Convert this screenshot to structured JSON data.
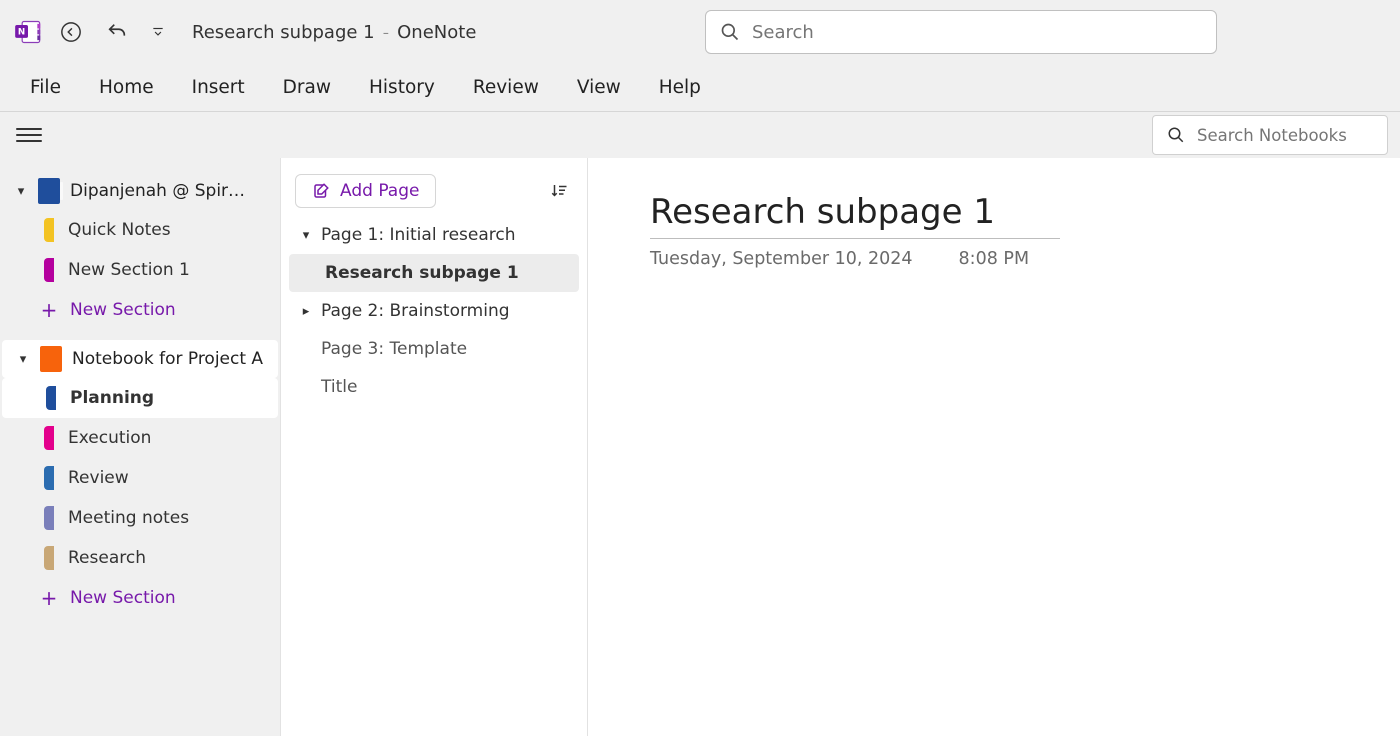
{
  "titlebar": {
    "page_name": "Research subpage 1",
    "app_name": "OneNote"
  },
  "search": {
    "placeholder": "Search"
  },
  "ribbon": [
    "File",
    "Home",
    "Insert",
    "Draw",
    "History",
    "Review",
    "View",
    "Help"
  ],
  "search_notebooks": {
    "placeholder": "Search Notebooks"
  },
  "sidebar": {
    "notebooks": [
      {
        "label": "Dipanjenah @ Spiral...",
        "color": "#1f4e9c",
        "expanded": true,
        "active": false,
        "sections": [
          {
            "label": "Quick Notes",
            "color": "#f3c323"
          },
          {
            "label": "New Section 1",
            "color": "#b4009e"
          }
        ],
        "new_section_label": "New Section"
      },
      {
        "label": "Notebook for Project A",
        "color": "#f7630c",
        "expanded": true,
        "active": true,
        "sections": [
          {
            "label": "Planning",
            "color": "#1f4e9c",
            "active": true
          },
          {
            "label": "Execution",
            "color": "#e3008c"
          },
          {
            "label": "Review",
            "color": "#2b6cb0"
          },
          {
            "label": "Meeting notes",
            "color": "#7a7fba"
          },
          {
            "label": "Research",
            "color": "#c8a776"
          }
        ],
        "new_section_label": "New Section"
      }
    ]
  },
  "page_list": {
    "add_page_label": "Add Page",
    "items": [
      {
        "label": "Page 1: Initial research",
        "chevron": "down"
      },
      {
        "label": "Research subpage 1",
        "sub": true,
        "selected": true
      },
      {
        "label": "Page 2: Brainstorming",
        "chevron": "right"
      },
      {
        "label": "Page 3: Template"
      },
      {
        "label": "Title"
      }
    ]
  },
  "content": {
    "title": "Research subpage 1",
    "date": "Tuesday, September 10, 2024",
    "time": "8:08 PM"
  }
}
